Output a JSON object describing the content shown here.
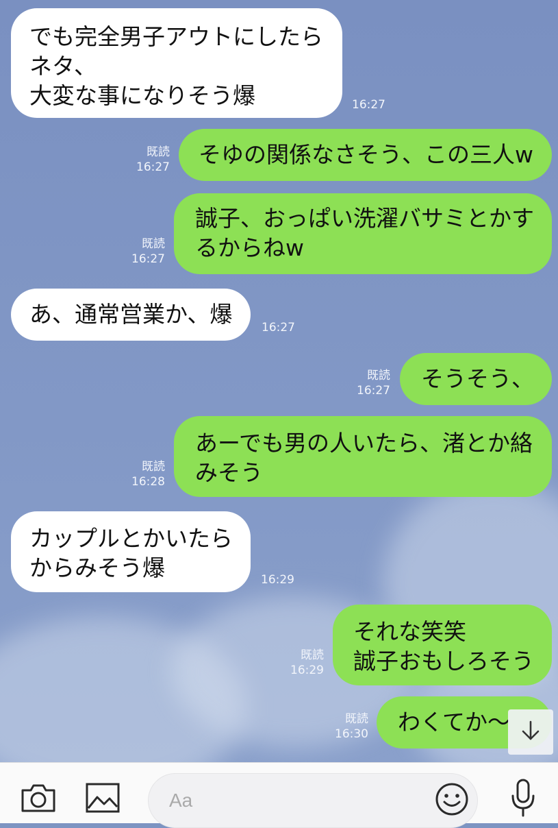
{
  "messages": [
    {
      "side": "in",
      "lines": [
        "でも完全男子アウトにしたら",
        "ネタ、",
        "大変な事になりそう爆"
      ],
      "time": "16:27"
    },
    {
      "side": "out",
      "lines": [
        "そゆの関係なさそう、この三人w"
      ],
      "read": "既読",
      "time": "16:27"
    },
    {
      "side": "out",
      "lines": [
        "誠子、おっぱい洗濯バサミとかす",
        "るからねw"
      ],
      "read": "既読",
      "time": "16:27"
    },
    {
      "side": "in",
      "lines": [
        "あ、通常営業か、爆"
      ],
      "time": "16:27"
    },
    {
      "side": "out",
      "lines": [
        "そうそう、"
      ],
      "read": "既読",
      "time": "16:27"
    },
    {
      "side": "out",
      "lines": [
        "あーでも男の人いたら、渚とか絡",
        "みそう"
      ],
      "read": "既読",
      "time": "16:28"
    },
    {
      "side": "in",
      "lines": [
        "カップルとかいたら",
        "からみそう爆"
      ],
      "time": "16:29"
    },
    {
      "side": "out",
      "lines": [
        "それな笑笑",
        "誠子おもしろそう"
      ],
      "read": "既読",
      "time": "16:29"
    },
    {
      "side": "out",
      "lines": [
        "わくてか〜"
      ],
      "read": "既読",
      "time": "16:30"
    }
  ],
  "input": {
    "placeholder": "Aa"
  },
  "icons": {
    "camera": "camera-icon",
    "image": "image-icon",
    "emoji": "emoji-icon",
    "mic": "microphone-icon",
    "scroll": "arrow-down-icon"
  },
  "colors": {
    "incoming": "#ffffff",
    "outgoing": "#8de055",
    "background": "#7d94c2"
  }
}
